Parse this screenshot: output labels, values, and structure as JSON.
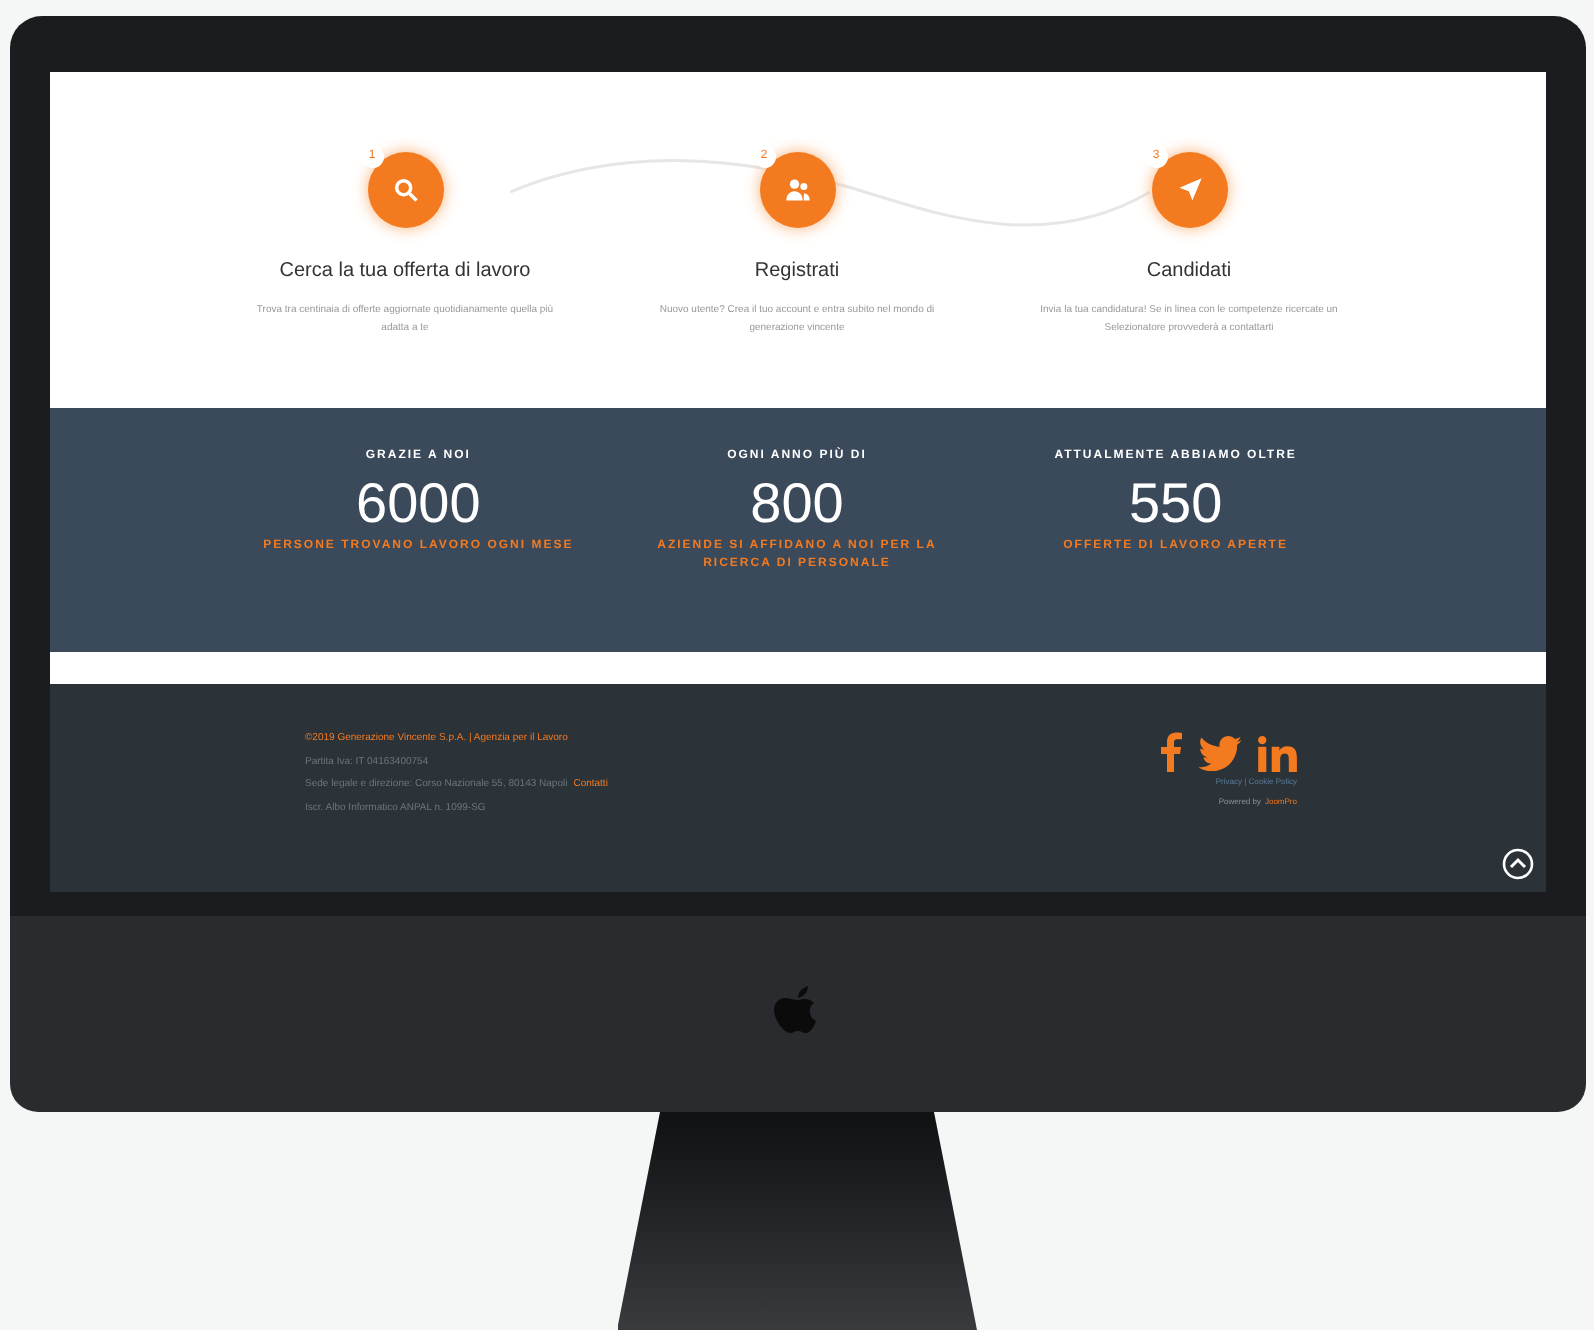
{
  "steps": [
    {
      "number": "1",
      "kind": "search",
      "title": "Cerca la tua offerta di lavoro",
      "text": "Trova tra centinaia di offerte aggiornate quotidianamente quella più adatta a te"
    },
    {
      "number": "2",
      "kind": "users",
      "title": "Registrati",
      "text": "Nuovo utente? Crea il tuo account e entra subito nel mondo di generazione vincente"
    },
    {
      "number": "3",
      "kind": "send",
      "title": "Candidati",
      "text": "Invia la tua candidatura! Se in linea con le competenze ricercate un Selezionatore provvederà a contattarti"
    }
  ],
  "stats": [
    {
      "label": "GRAZIE A NOI",
      "value": "6000",
      "caption": "PERSONE TROVANO LAVORO OGNI MESE"
    },
    {
      "label": "OGNI ANNO PIÙ DI",
      "value": "800",
      "caption": "AZIENDE SI AFFIDANO A NOI PER LA RICERCA DI PERSONALE"
    },
    {
      "label": "ATTUALMENTE ABBIAMO OLTRE",
      "value": "550",
      "caption": "OFFERTE DI LAVORO APERTE"
    }
  ],
  "footer": {
    "company": "©2019 Generazione Vincente S.p.A. | Agenzia per il Lavoro",
    "lines": [
      "Partita Iva: IT 04163400754",
      "Sede legale e direzione: Corso Nazionale 55, 80143 Napoli",
      "Iscr. Albo Informatico ANPAL n. 1099-SG"
    ],
    "link": "Contatti",
    "social": [
      {
        "kind": "facebook"
      },
      {
        "kind": "twitter"
      },
      {
        "kind": "linkedin"
      }
    ],
    "legal": "Privacy | Cookie Policy",
    "credit_prefix": "Powered by",
    "credit_link": "JoomPro"
  }
}
